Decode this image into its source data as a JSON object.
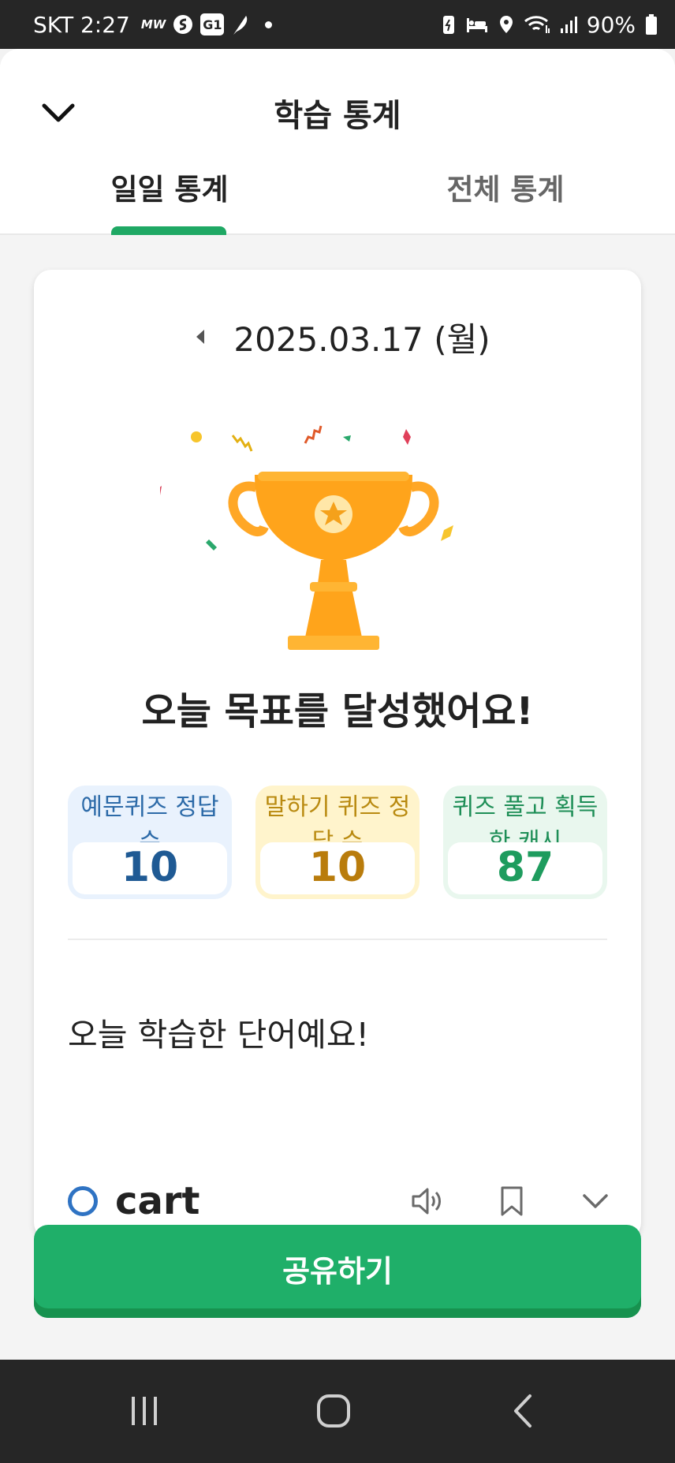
{
  "status_bar": {
    "carrier_time": "SKT 2:27",
    "mini_label": "MW",
    "box_label": "G1",
    "battery": "90%",
    "icons": [
      "mw-icon",
      "s-icon",
      "g1-icon",
      "feather-icon",
      "battery-saver-icon",
      "bed-icon",
      "location-icon",
      "wifi-icon",
      "signal-icon",
      "battery-icon"
    ]
  },
  "header": {
    "title": "학습 통계",
    "close_icon": "chevron-down-icon"
  },
  "tabs": [
    {
      "label": "일일 통계",
      "active": true
    },
    {
      "label": "전체 통계",
      "active": false
    }
  ],
  "card": {
    "date": "2025.03.17 (월)",
    "prev_icon": "caret-left-icon",
    "illustration": "trophy-icon",
    "goal_message": "오늘 목표를 달성했어요!",
    "stats": [
      {
        "label": "예문퀴즈 정답 수",
        "value": "10",
        "color": "#1f5a94"
      },
      {
        "label": "말하기 퀴즈 정답 수",
        "value": "10",
        "color": "#b97c0c"
      },
      {
        "label": "퀴즈 풀고 획득한 캐시",
        "value": "87",
        "color": "#1e9c5e"
      }
    ],
    "words_heading": "오늘 학습한 단어예요!",
    "words": [
      {
        "word": "cart",
        "status_icon": "circle-icon",
        "action_icons": [
          "speaker-icon",
          "bookmark-icon",
          "chevron-down-icon"
        ]
      }
    ]
  },
  "share_button": {
    "label": "공유하기",
    "color": "#1faf69"
  },
  "nav_bar": {
    "icons": [
      "recent-apps-icon",
      "home-icon",
      "back-icon"
    ]
  }
}
